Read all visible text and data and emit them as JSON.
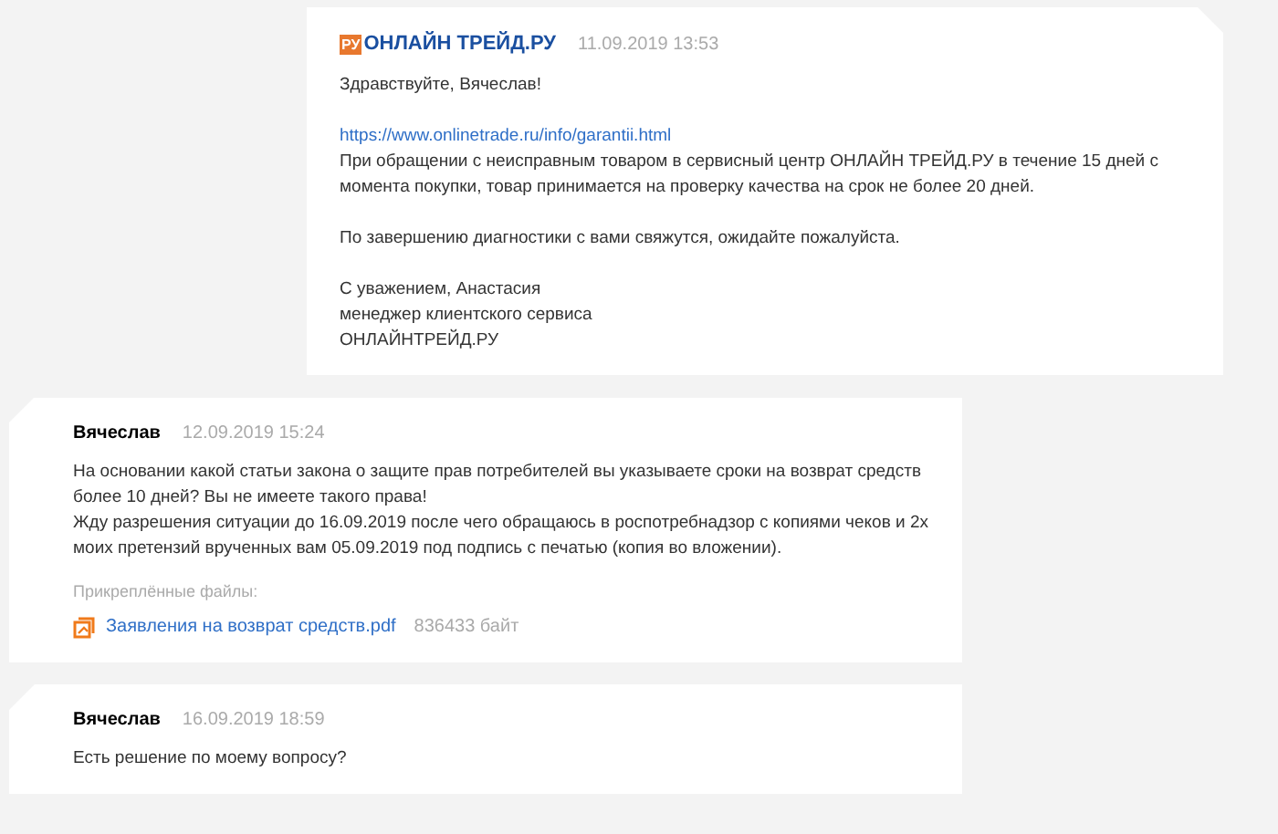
{
  "messages": [
    {
      "kind": "shop",
      "logo_text": "РУ",
      "author": "ОНЛАЙН ТРЕЙД.РУ",
      "time": "11.09.2019 13:53",
      "paragraphs": [
        [
          {
            "kind": "text",
            "text": "Здравствуйте, Вячеслав!"
          }
        ],
        [
          {
            "kind": "link",
            "text": "https://www.onlinetrade.ru/info/garantii.html"
          },
          {
            "kind": "text",
            "text": "При обращении с неисправным товаром в сервисный центр ОНЛАЙН ТРЕЙД.РУ в течение 15 дней с момента покупки, товар принимается на проверку качества на срок не более 20 дней."
          }
        ],
        [
          {
            "kind": "text",
            "text": "По завершению диагностики с вами свяжутся, ожидайте пожалуйста."
          }
        ],
        [
          {
            "kind": "text",
            "text": "С уважением, Анастасия"
          },
          {
            "kind": "text",
            "text": "менеджер клиентского сервиса"
          },
          {
            "kind": "text",
            "text": "ОНЛАЙНТРЕЙД.РУ"
          }
        ]
      ]
    },
    {
      "kind": "customer",
      "author": "Вячеслав",
      "time": "12.09.2019 15:24",
      "paragraphs": [
        [
          {
            "kind": "text",
            "text": "На основании какой статьи закона о защите прав потребителей вы указываете сроки на возврат средств более 10 дней? Вы не имеете такого права!"
          },
          {
            "kind": "text",
            "text": "Жду разрешения ситуации до 16.09.2019 после чего обращаюсь в роспотребнадзор с копиями чеков и 2х моих претензий врученных вам 05.09.2019 под подпись с печатью (копия во вложении)."
          }
        ]
      ],
      "attachments": {
        "label": "Прикреплённые файлы:",
        "files": [
          {
            "name": "Заявления на возврат средств.pdf",
            "size": "836433 байт"
          }
        ]
      }
    },
    {
      "kind": "customer",
      "author": "Вячеслав",
      "time": "16.09.2019 18:59",
      "paragraphs": [
        [
          {
            "kind": "text",
            "text": "Есть решение по моему вопросу?"
          }
        ]
      ]
    }
  ]
}
